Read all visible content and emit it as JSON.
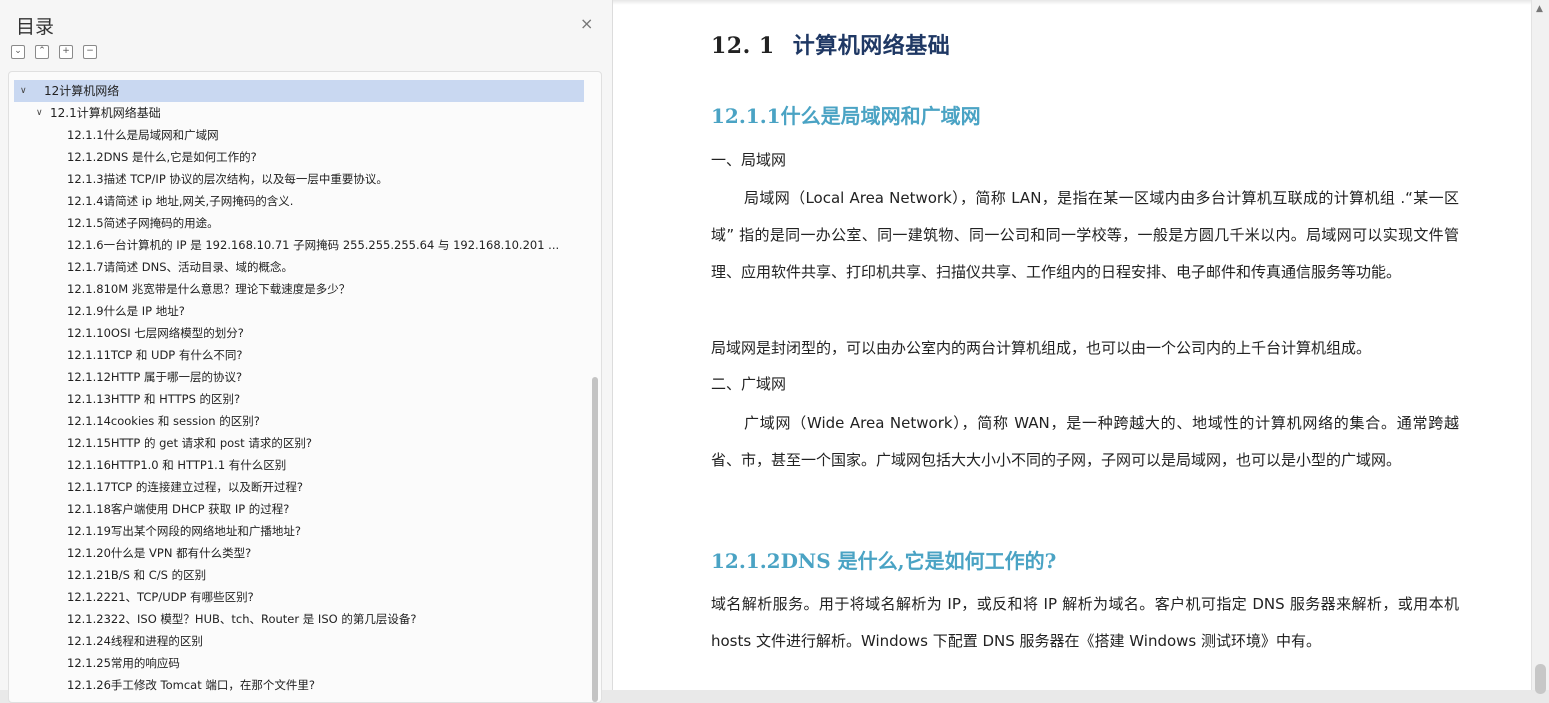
{
  "toc": {
    "title": "目录",
    "close": "×",
    "tools": [
      "⌄",
      "⌃",
      "+",
      "−"
    ],
    "items": [
      {
        "level": 1,
        "label": "12计算机网络",
        "selected": true
      },
      {
        "level": 2,
        "label": "12.1计算机网络基础"
      },
      {
        "level": 3,
        "label": "12.1.1什么是局域网和广域网"
      },
      {
        "level": 3,
        "label": "12.1.2DNS 是什么,它是如何工作的?"
      },
      {
        "level": 3,
        "label": "12.1.3描述 TCP/IP 协议的层次结构，以及每一层中重要协议。"
      },
      {
        "level": 3,
        "label": "12.1.4请简述  ip  地址,网关,子网掩码的含义."
      },
      {
        "level": 3,
        "label": "12.1.5简述子网掩码的用途。"
      },
      {
        "level": 3,
        "label": "12.1.6一台计算机的  IP  是  192.168.10.71  子网掩码  255.255.255.64  与  192.168.10.201   ..."
      },
      {
        "level": 3,
        "label": "12.1.7请简述 DNS、活动目录、域的概念。"
      },
      {
        "level": 3,
        "label": "12.1.810M  兆宽带是什么意思？理论下载速度是多少？"
      },
      {
        "level": 3,
        "label": "12.1.9什么是 IP  地址?"
      },
      {
        "level": 3,
        "label": "12.1.10OSI  七层网络模型的划分?"
      },
      {
        "level": 3,
        "label": "12.1.11TCP  和  UDP  有什么不同?"
      },
      {
        "level": 3,
        "label": "12.1.12HTTP  属于哪一层的协议?"
      },
      {
        "level": 3,
        "label": "12.1.13HTTP  和  HTTPS  的区别?"
      },
      {
        "level": 3,
        "label": "12.1.14cookies  和 session  的区别?"
      },
      {
        "level": 3,
        "label": "12.1.15HTTP  的 get  请求和 post  请求的区别?"
      },
      {
        "level": 3,
        "label": "12.1.16HTTP1.0  和  HTTP1.1  有什么区别"
      },
      {
        "level": 3,
        "label": "12.1.17TCP  的连接建立过程，以及断开过程?"
      },
      {
        "level": 3,
        "label": "12.1.18客户端使用  DHCP  获取 IP  的过程?"
      },
      {
        "level": 3,
        "label": "12.1.19写出某个网段的网络地址和广播地址?"
      },
      {
        "level": 3,
        "label": "12.1.20什么是  VPN  都有什么类型?"
      },
      {
        "level": 3,
        "label": "12.1.21B/S  和  C/S  的区别"
      },
      {
        "level": 3,
        "label": "12.1.2221、TCP/UDP 有哪些区别?"
      },
      {
        "level": 3,
        "label": "12.1.2322、ISO 模型？HUB、tch、Router 是 ISO 的第几层设备?"
      },
      {
        "level": 3,
        "label": "12.1.24线程和进程的区别"
      },
      {
        "level": 3,
        "label": "12.1.25常用的响应码"
      },
      {
        "level": 3,
        "label": "12.1.26手工修改  Tomcat  端口，在那个文件里?"
      }
    ]
  },
  "doc": {
    "h1_num": "12. 1",
    "h1_text": "计算机网络基础",
    "h2_1": "12.1.1什么是局域网和广域网",
    "lan_heading": "一、局域网",
    "lan_para1": "局域网（Local Area Network），简称  LAN，是指在某一区域内由多台计算机互联成的计算机组 .“某一区域” 指的是同一办公室、同一建筑物、同一公司和同一学校等，一般是方圆几千米以内。局域网可以实现文件管理、应用软件共享、打印机共享、扫描仪共享、工作组内的日程安排、电子邮件和传真通信服务等功能。",
    "lan_para2": "局域网是封闭型的，可以由办公室内的两台计算机组成，也可以由一个公司内的上千台计算机组成。",
    "wan_heading": "二、广域网",
    "wan_para": "广域网（Wide Area Network），简称  WAN，是一种跨越大的、地域性的计算机网络的集合。通常跨越省、市，甚至一个国家。广域网包括大大小小不同的子网，子网可以是局域网，也可以是小型的广域网。",
    "h2_2": "12.1.2DNS 是什么,它是如何工作的?",
    "dns_para": "域名解析服务。用于将域名解析为 IP，或反和将 IP 解析为域名。客户机可指定 DNS 服务器来解析，或用本机 hosts 文件进行解析。Windows 下配置 DNS 服务器在《搭建 Windows 测试环境》中有。"
  }
}
